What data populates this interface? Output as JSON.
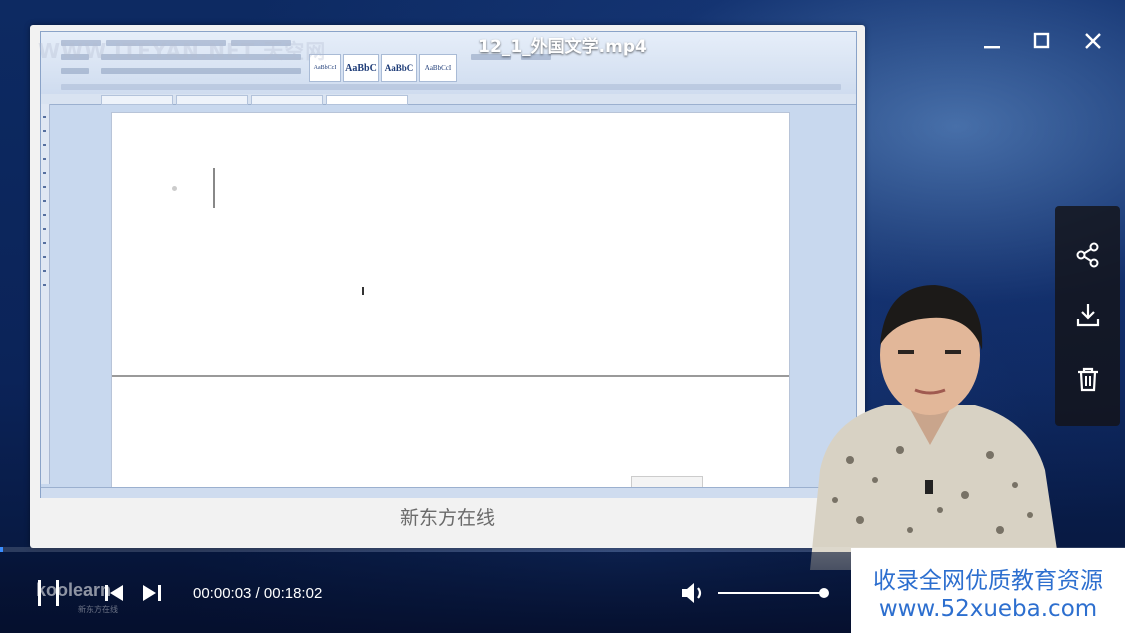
{
  "window": {
    "title": "12_1_外国文学.mp4",
    "minimize_icon": "minimize-icon",
    "maximize_icon": "maximize-icon",
    "close_icon": "close-icon"
  },
  "video": {
    "watermark_top": "WWW.ITEYAN.NET 天空网",
    "caption": "新东方在线",
    "word_style_1": "AaBbC",
    "word_style_2": "AaBbC",
    "word_style_3": "AaBbCcI"
  },
  "side_panel": {
    "items": [
      {
        "name": "share",
        "icon": "share-icon"
      },
      {
        "name": "download",
        "icon": "download-icon"
      },
      {
        "name": "delete",
        "icon": "trash-icon"
      }
    ]
  },
  "player": {
    "progress": 0.003,
    "current_time": "00:00:03",
    "total_time": "00:18:02",
    "time_display": "00:00:03 / 00:18:02",
    "volume": 1.0,
    "brand_logo": "koolearn",
    "brand_sub": "新东方在线",
    "accent_color": "#3a8dff"
  },
  "ad": {
    "line1": "收录全网优质教育资源",
    "line2": "www.52xueba.com",
    "color": "#2d6fcf"
  }
}
